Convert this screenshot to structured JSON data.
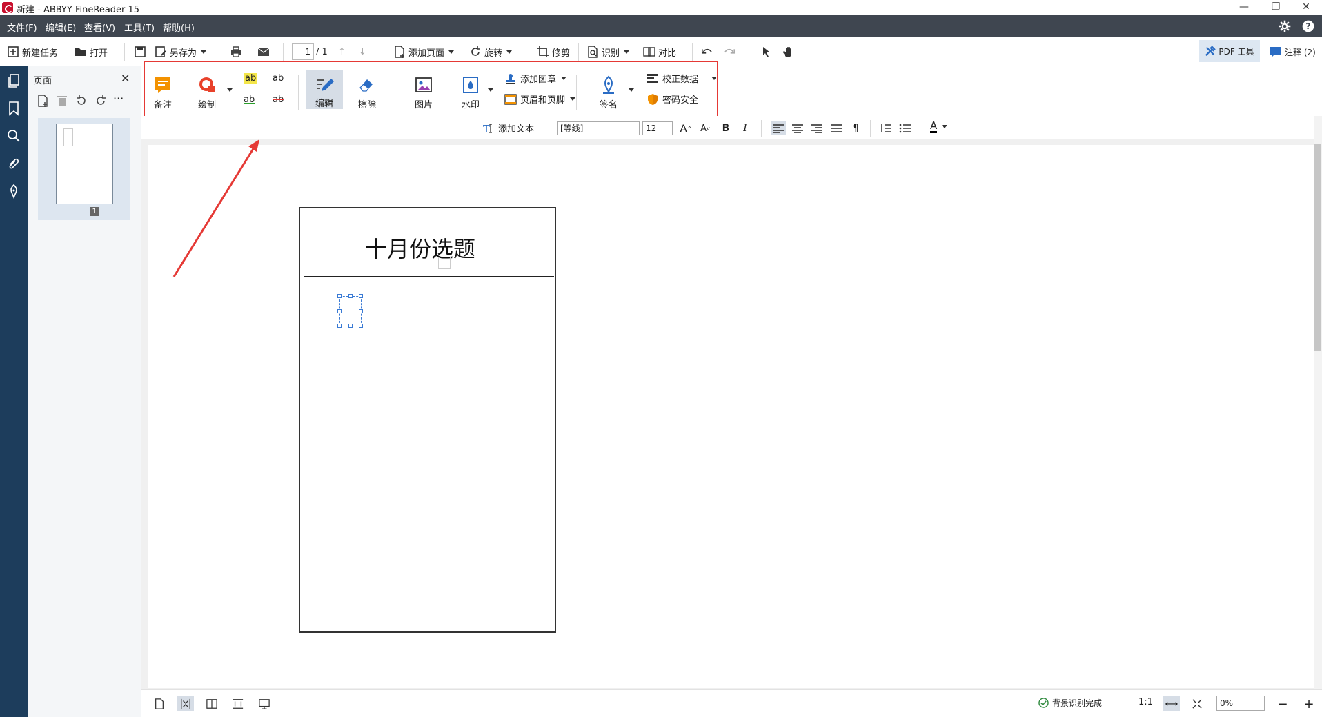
{
  "window": {
    "title": "新建 - ABBYY FineReader 15"
  },
  "menu": {
    "items": [
      "文件(F)",
      "编辑(E)",
      "查看(V)",
      "工具(T)",
      "帮助(H)"
    ]
  },
  "toolbar": {
    "new_task": "新建任务",
    "open": "打开",
    "save_as": "另存为",
    "page_current": "1",
    "page_total": "/ 1",
    "add_page": "添加页面",
    "rotate": "旋转",
    "crop": "修剪",
    "recognize": "识别",
    "compare": "对比",
    "pdf_tools": "PDF 工具",
    "comments": "注释 (2)"
  },
  "pages_panel": {
    "title": "页面",
    "thumb_number": "1"
  },
  "ribbon": {
    "note": "备注",
    "draw": "绘制",
    "highlight": "ab",
    "underline": "ab",
    "textmark": "ab",
    "strike": "ab",
    "edit": "编辑",
    "erase": "擦除",
    "image": "图片",
    "watermark": "水印",
    "add_stamp": "添加图章",
    "header_footer": "页眉和页脚",
    "sign": "签名",
    "redact": "校正数据",
    "password": "密码安全"
  },
  "format": {
    "add_text": "添加文本",
    "font": "[等线]",
    "size": "12",
    "bold": "B",
    "italic": "I",
    "text_color": "A"
  },
  "document": {
    "title_text": "十月份选题"
  },
  "status": {
    "bg_recognition": "背景识别完成",
    "ratio": "1:1",
    "zoom": "0%"
  },
  "colors": {
    "accent": "#e53935",
    "nav": "#1d3d5c",
    "menubar": "#3f4650"
  }
}
